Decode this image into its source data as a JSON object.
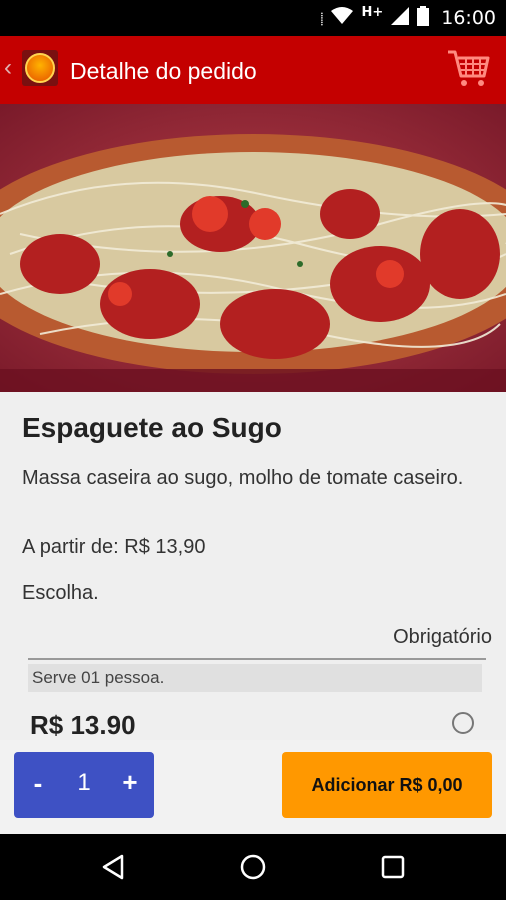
{
  "status_bar": {
    "network": "H+",
    "time": "16:00"
  },
  "app_bar": {
    "back_icon": "chevron-left-icon",
    "title": "Detalhe do pedido",
    "cart_icon": "cart-icon"
  },
  "hero_image": {
    "description_icon": "spaghetti-photo"
  },
  "product": {
    "name": "Espaguete ao Sugo",
    "description": "Massa caseira ao sugo, molho de tomate caseiro.",
    "price_from": "A partir de: R$ 13,90"
  },
  "options": {
    "choose_label": "Escolha.",
    "required_label": "Obrigatório",
    "items": [
      {
        "description": "Serve 01 pessoa.",
        "price": "R$ 13.90",
        "selected": false
      }
    ]
  },
  "order_bar": {
    "minus_label": "-",
    "quantity": "1",
    "plus_label": "+",
    "add_label": "Adicionar R$ 0,00"
  },
  "colors": {
    "app_bar": "#c40000",
    "stepper": "#3e51c4",
    "add_button": "#ff9800"
  }
}
